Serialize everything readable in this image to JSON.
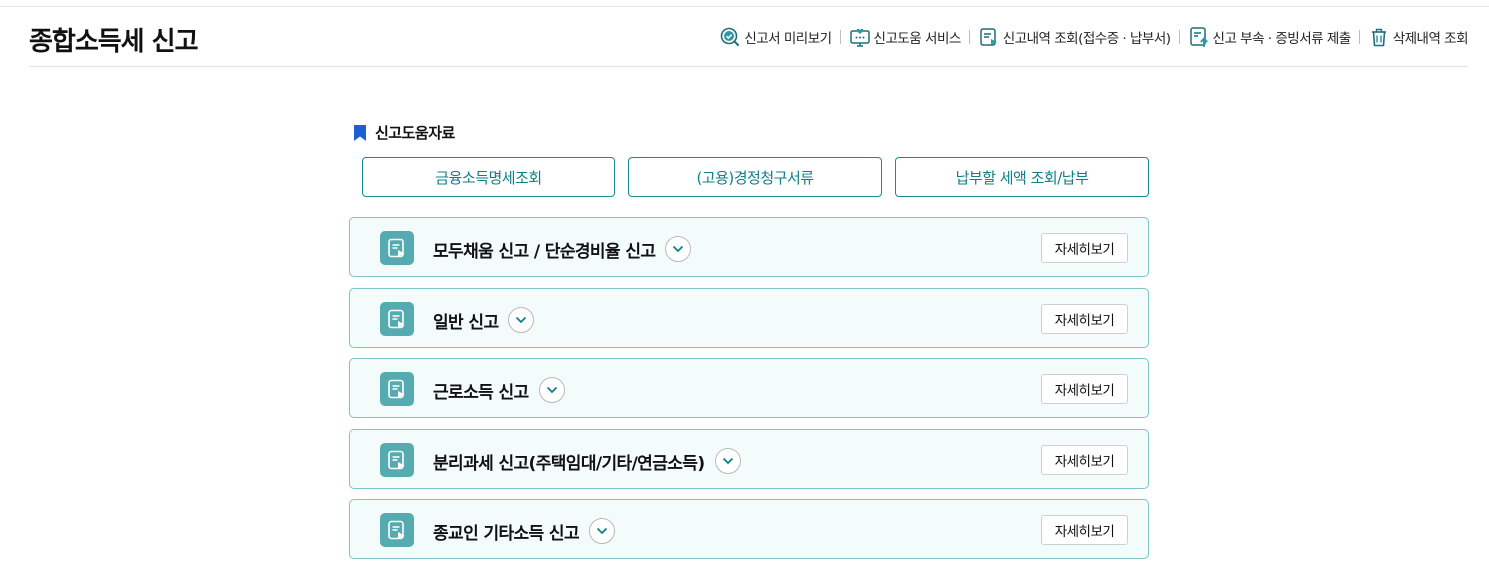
{
  "header": {
    "title": "종합소득세 신고",
    "utility_nav": [
      {
        "label": "신고서 미리보기",
        "icon": "magnifier-check-icon"
      },
      {
        "label": "신고도움 서비스",
        "icon": "monitor-heart-icon"
      },
      {
        "label": "신고내역 조회(접수증 · 납부서)",
        "icon": "document-arrow-icon"
      },
      {
        "label": "신고 부속 · 증빙서류 제출",
        "icon": "document-upload-icon"
      },
      {
        "label": "삭제내역 조회",
        "icon": "trash-icon"
      }
    ]
  },
  "help_section": {
    "title": "신고도움자료",
    "buttons": [
      "금융소득명세조회",
      "(고용)경정청구서류",
      "납부할 세액 조회/납부"
    ]
  },
  "filing_types": [
    {
      "title": "모두채움 신고 / 단순경비율 신고",
      "detail_label": "자세히보기"
    },
    {
      "title": "일반 신고",
      "detail_label": "자세히보기"
    },
    {
      "title": "근로소득 신고",
      "detail_label": "자세히보기"
    },
    {
      "title": "분리과세 신고(주택임대/기타/연금소득)",
      "detail_label": "자세히보기"
    },
    {
      "title": "종교인 기타소득 신고",
      "detail_label": "자세히보기"
    }
  ],
  "colors": {
    "accent": "#0f7f88",
    "card_border": "#7fc4c6",
    "card_bg": "#f4fbfb",
    "icon_bg": "#55abb0",
    "bookmark": "#1f5fd6"
  }
}
